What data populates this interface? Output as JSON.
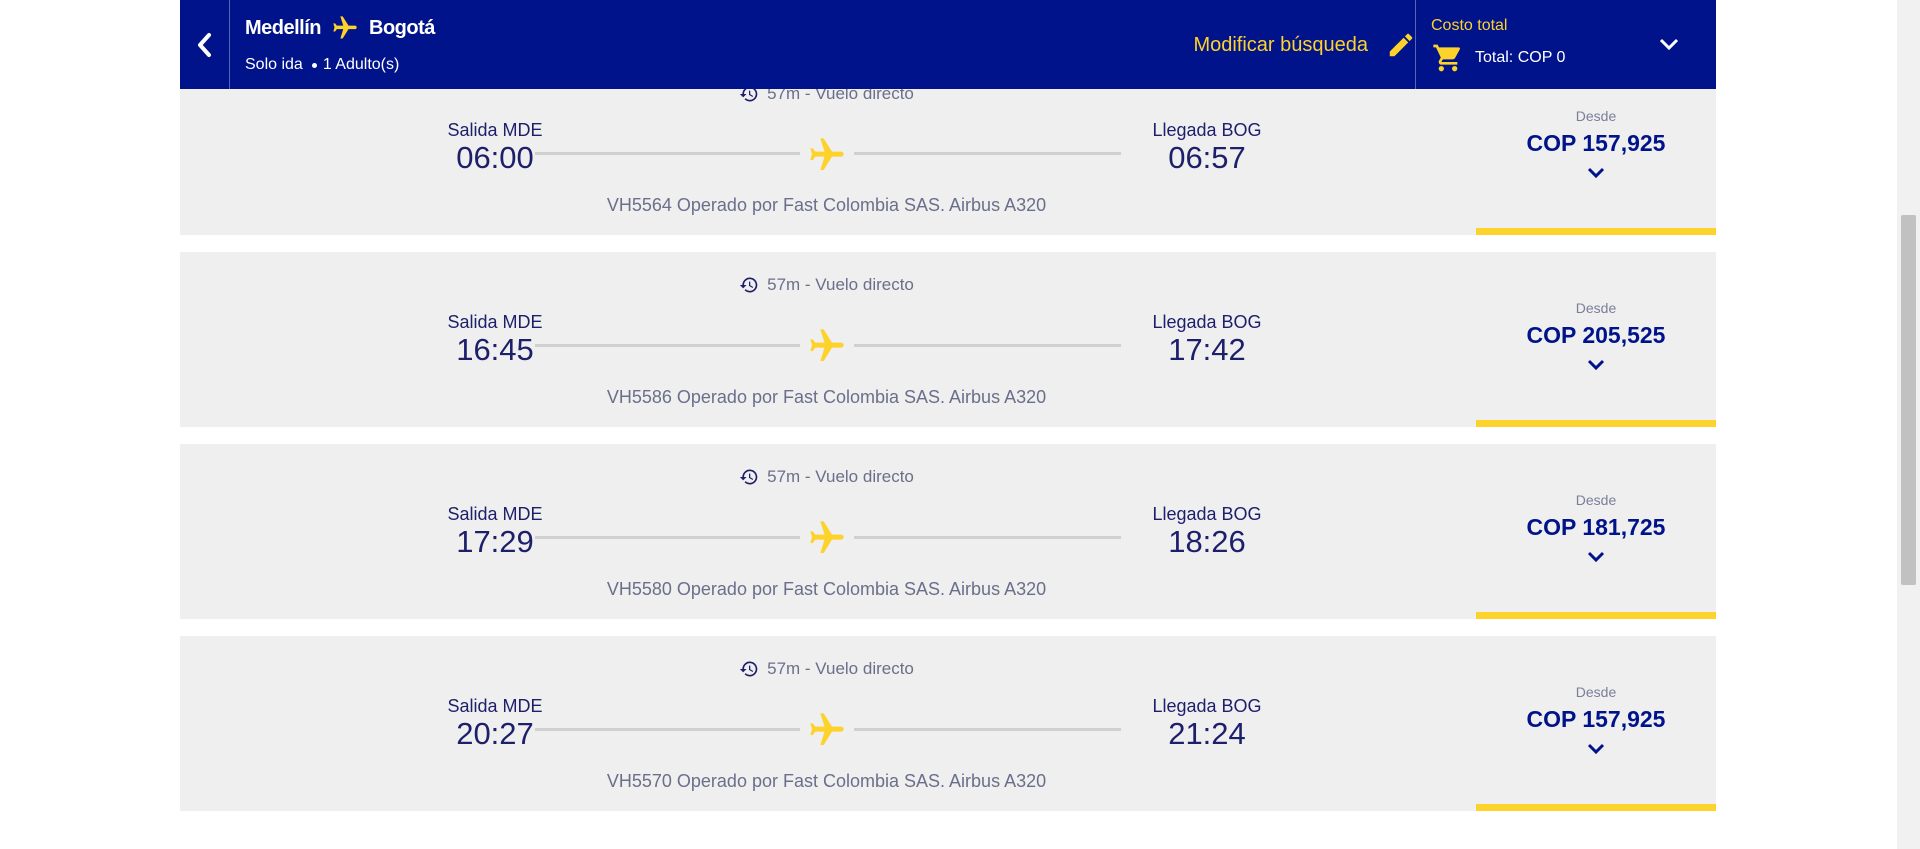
{
  "header": {
    "origin": "Medellín",
    "destination": "Bogotá",
    "trip_type": "Solo ida",
    "passengers": "1 Adulto(s)",
    "modify_label": "Modificar búsqueda",
    "cost_label": "Costo total",
    "cost_total": "Total: COP 0"
  },
  "colors": {
    "header_bg": "#00138a",
    "accent_yellow": "#fdd22b",
    "card_bg": "#efefef",
    "text_navy": "#1d1f6b"
  },
  "flights": [
    {
      "duration": "57m - Vuelo directo",
      "dep_label": "Salida MDE",
      "dep_time": "06:00",
      "arr_label": "Llegada BOG",
      "arr_time": "06:57",
      "info": "VH5564 Operado por Fast Colombia SAS. Airbus A320",
      "from_label": "Desde",
      "price": "COP 157,925"
    },
    {
      "duration": "57m - Vuelo directo",
      "dep_label": "Salida MDE",
      "dep_time": "16:45",
      "arr_label": "Llegada BOG",
      "arr_time": "17:42",
      "info": "VH5586 Operado por Fast Colombia SAS. Airbus A320",
      "from_label": "Desde",
      "price": "COP 205,525"
    },
    {
      "duration": "57m - Vuelo directo",
      "dep_label": "Salida MDE",
      "dep_time": "17:29",
      "arr_label": "Llegada BOG",
      "arr_time": "18:26",
      "info": "VH5580 Operado por Fast Colombia SAS. Airbus A320",
      "from_label": "Desde",
      "price": "COP 181,725"
    },
    {
      "duration": "57m - Vuelo directo",
      "dep_label": "Salida MDE",
      "dep_time": "20:27",
      "arr_label": "Llegada BOG",
      "arr_time": "21:24",
      "info": "VH5570 Operado por Fast Colombia SAS. Airbus A320",
      "from_label": "Desde",
      "price": "COP 157,925"
    }
  ]
}
